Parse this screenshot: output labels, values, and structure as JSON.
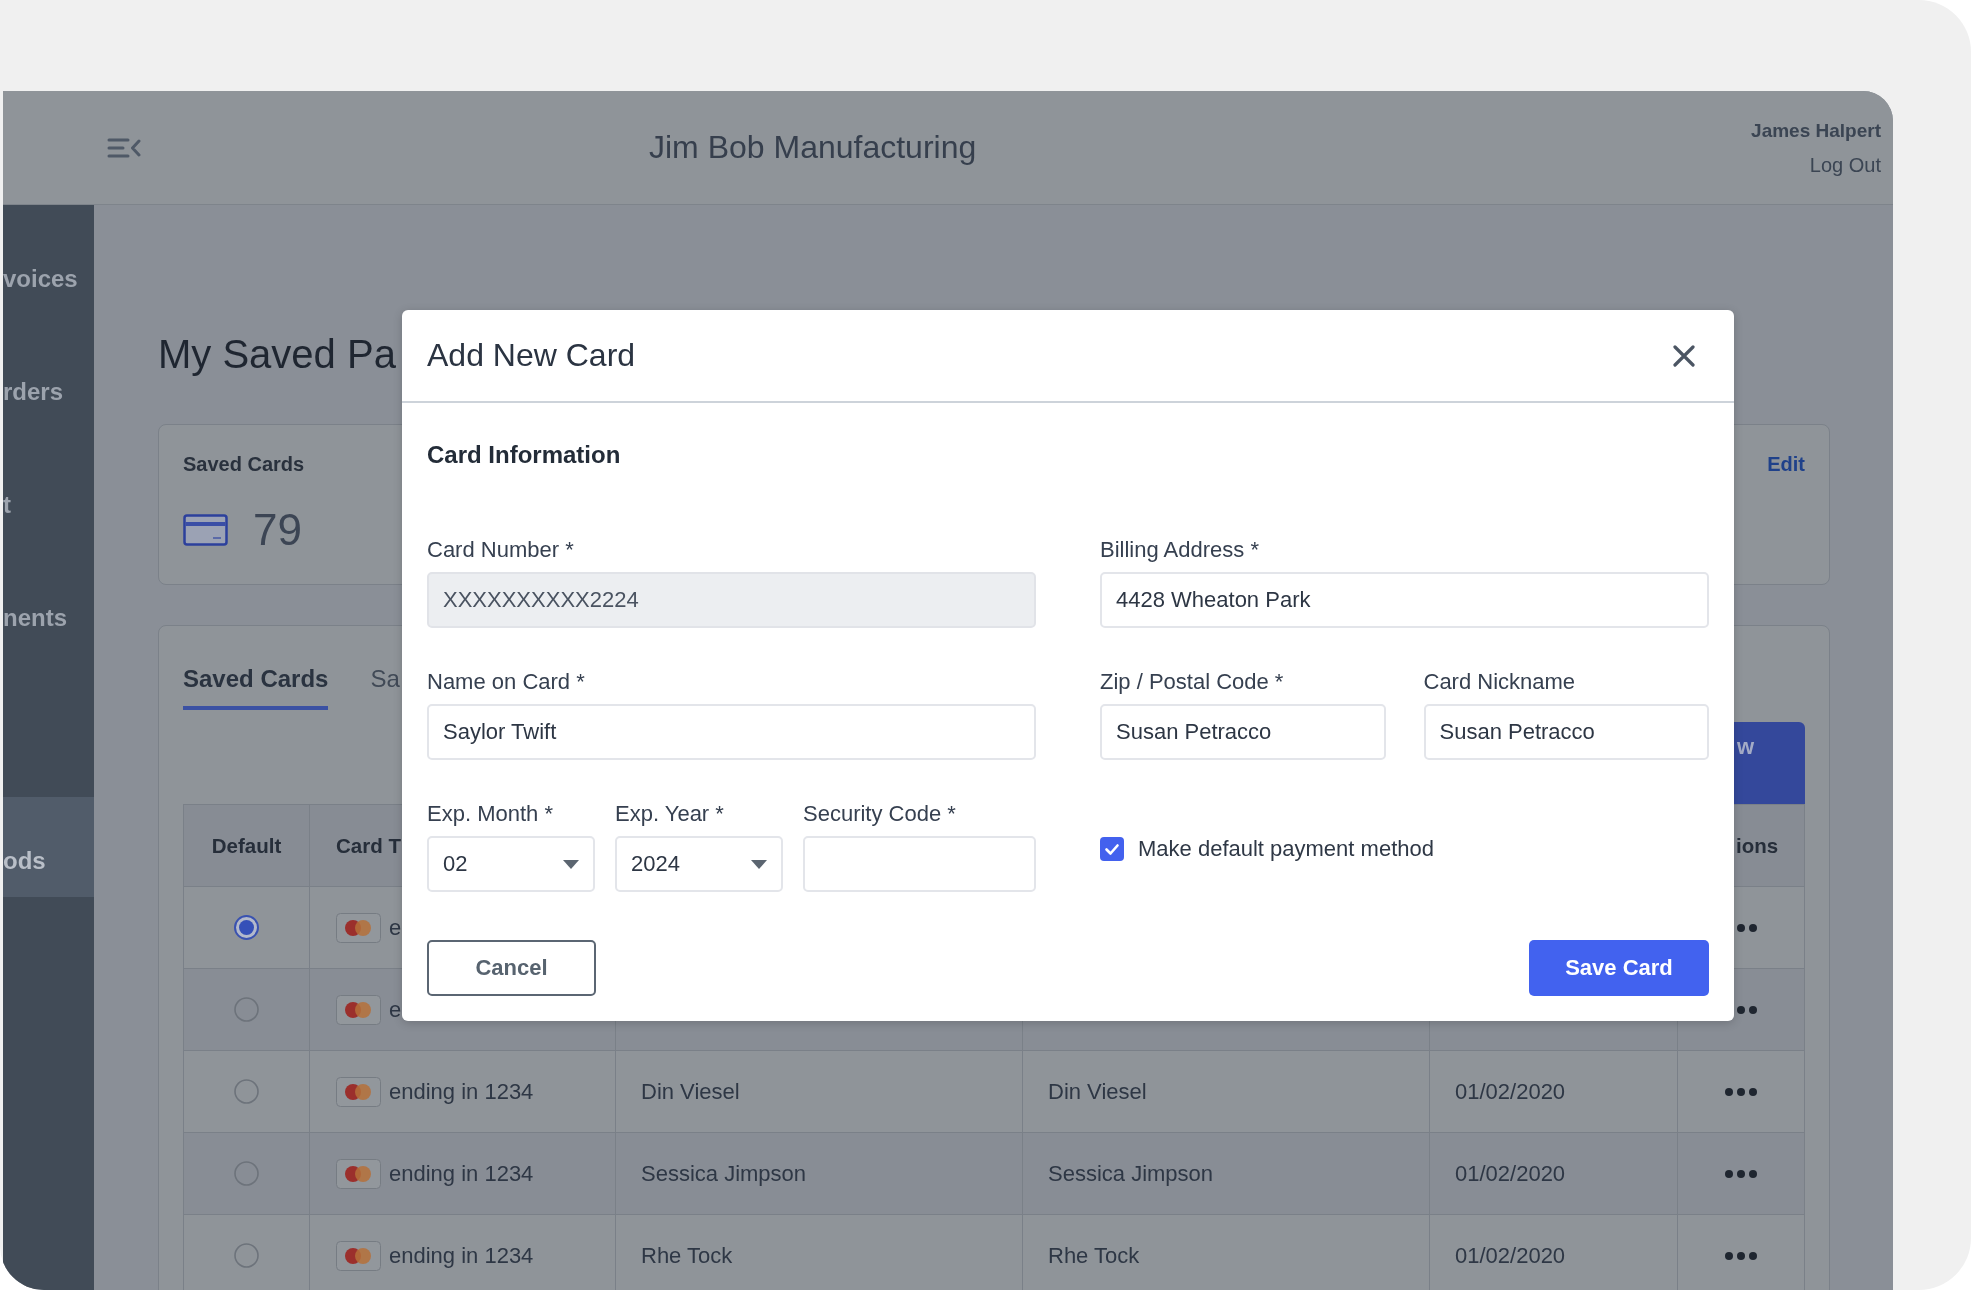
{
  "header": {
    "title": "Jim Bob Manufacturing",
    "user_name": "James Halpert",
    "logout": "Log Out"
  },
  "sidebar": {
    "items": [
      {
        "label": "voices",
        "selected": false
      },
      {
        "label": "rders",
        "selected": false
      },
      {
        "label": "t",
        "selected": false
      },
      {
        "label": "nents",
        "selected": false
      },
      {
        "label": "ods",
        "selected": true
      }
    ]
  },
  "page_title": "My Saved Pa",
  "summary_card": {
    "title": "Saved Cards",
    "count": "79",
    "edit": "Edit"
  },
  "tabs": [
    {
      "label": "Saved Cards",
      "selected": true
    },
    {
      "label": "Sa",
      "selected": false
    }
  ],
  "toolbar_button": {
    "label": "w"
  },
  "table": {
    "columns": {
      "default": "Default",
      "column_2": "Card T",
      "column_6": "ions"
    },
    "rows": [
      {
        "selected": true,
        "column_2": "e"
      },
      {
        "selected": false,
        "column_2": "e"
      },
      {
        "selected": false,
        "column_2": "ending in 1234",
        "column_3": "Din Viesel",
        "column_4": "Din Viesel",
        "column_5": "01/02/2020"
      },
      {
        "selected": false,
        "column_2": "ending in 1234",
        "column_3": "Sessica Jimpson",
        "column_4": "Sessica Jimpson",
        "column_5": "01/02/2020"
      },
      {
        "selected": false,
        "column_2": "ending in 1234",
        "column_3": "Rhe Tock",
        "column_4": "Rhe Tock",
        "column_5": "01/02/2020"
      }
    ]
  },
  "modal": {
    "title": "Add New Card",
    "section_title": "Card Information",
    "left_column": [
      {
        "fields": [
          {
            "label": "Card Number *",
            "value": "XXXXXXXXXX2224",
            "kind": "text",
            "disabled": true
          }
        ]
      },
      {
        "fields": [
          {
            "label": "Name on Card *",
            "value": "Saylor Twift",
            "kind": "text",
            "disabled": false
          }
        ]
      },
      {
        "fields": [
          {
            "label": "Exp. Month *",
            "value": "02",
            "kind": "select",
            "disabled": false
          },
          {
            "label": "Exp. Year *",
            "value": "2024",
            "kind": "select",
            "disabled": false
          },
          {
            "label": "Security Code *",
            "kind": "text",
            "disabled": false
          }
        ]
      }
    ],
    "right_column": [
      {
        "fields": [
          {
            "label": "Billing Address *",
            "value": "4428 Wheaton Park",
            "kind": "text",
            "disabled": false
          }
        ]
      },
      {
        "fields": [
          {
            "label": "Zip / Postal Code *",
            "value": "Susan Petracco",
            "kind": "text",
            "disabled": false
          },
          {
            "label": "Card Nickname",
            "value": "Susan Petracco",
            "kind": "text",
            "disabled": false
          }
        ]
      }
    ],
    "default_checkbox": {
      "label": "Make default payment method",
      "checked": true
    },
    "buttons": [
      {
        "label": "Cancel",
        "kind": "secondary"
      },
      {
        "label": "Save Card",
        "kind": "primary"
      }
    ]
  }
}
